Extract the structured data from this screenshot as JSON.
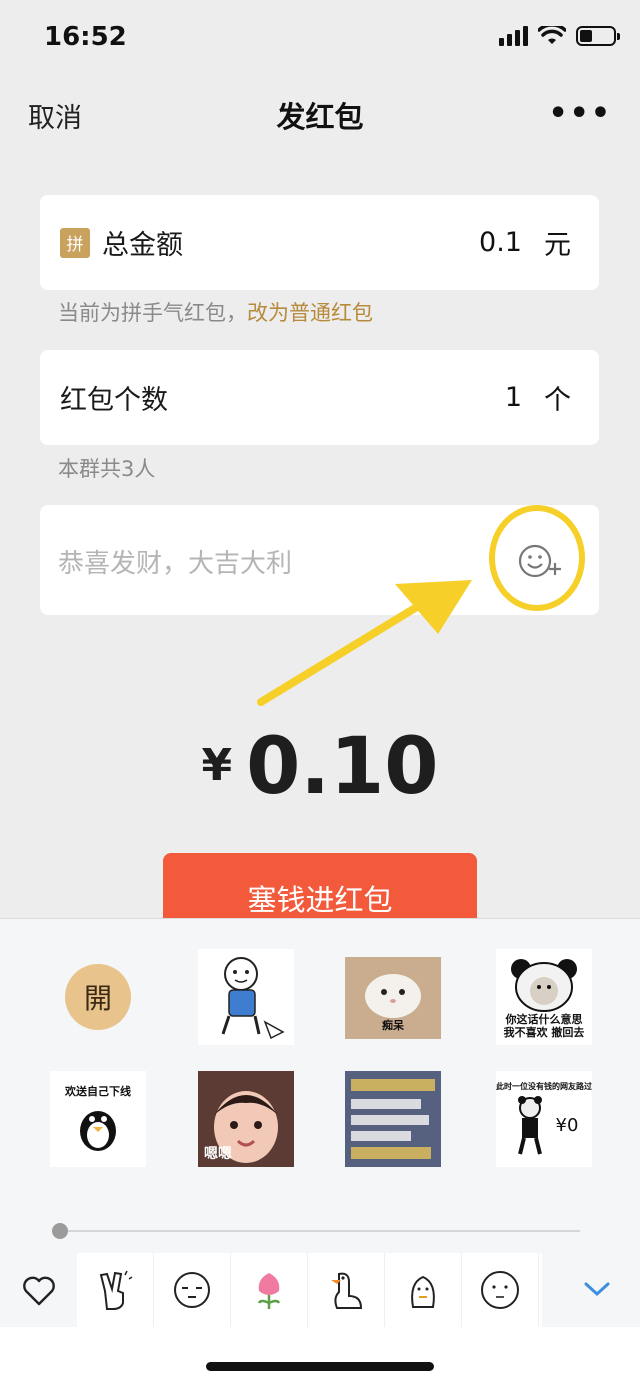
{
  "status_bar": {
    "time": "16:52"
  },
  "nav": {
    "cancel": "取消",
    "title": "发红包",
    "more": "•••"
  },
  "total_amount": {
    "badge": "拼",
    "label": "总金额",
    "value": "0.1",
    "unit": "元"
  },
  "type_hint": {
    "text": "当前为拼手气红包，",
    "link": "改为普通红包"
  },
  "count": {
    "label": "红包个数",
    "value": "1",
    "unit": "个"
  },
  "group_hint": "本群共3人",
  "greeting": {
    "placeholder": "恭喜发财，大吉大利"
  },
  "amount": {
    "currency": "¥",
    "value": "0.10"
  },
  "send_button": "塞钱进红包",
  "stickers": {
    "open_label": "開",
    "s_dunno": "痴呆",
    "s_panda_line1": "你这话什么意思",
    "s_panda_line2": "我不喜欢 撤回去",
    "s_offline": "欢送自己下线",
    "s_girl": "嗯嗯",
    "s_broke_top": "此时一位没有钱的网友路过",
    "s_broke_amount": "¥0"
  },
  "colors": {
    "accent_red": "#f25a3b",
    "gold": "#c9a25e",
    "highlight_yellow": "#f6cf28",
    "link_gold": "#b88a3c"
  },
  "icons": [
    "signal-icon",
    "wifi-icon",
    "battery-icon",
    "more-icon",
    "emoji-add-icon",
    "heart-icon",
    "chevron-down-icon"
  ]
}
